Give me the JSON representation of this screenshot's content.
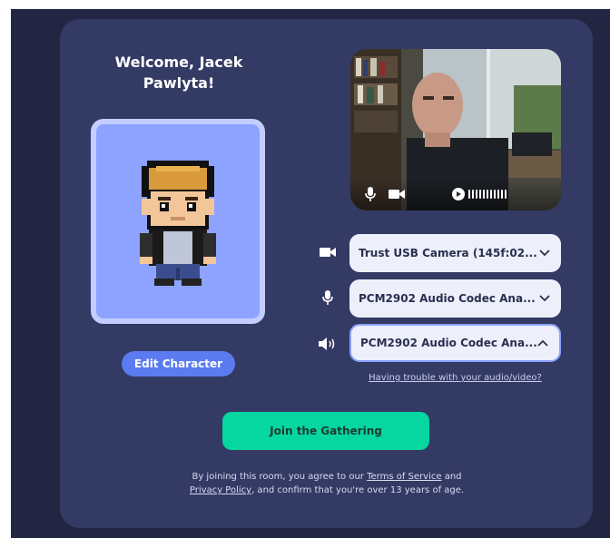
{
  "welcome": {
    "title": "Welcome, Jacek Pawlyta!"
  },
  "avatar": {
    "icon": "pixel-character-avatar",
    "edit_label": "Edit Character"
  },
  "video": {
    "controls": [
      {
        "icon": "microphone-icon"
      },
      {
        "icon": "video-camera-icon"
      },
      {
        "icon": "play-icon"
      }
    ],
    "audio_level_bars": 11
  },
  "devices": {
    "camera": {
      "icon": "video-camera-icon",
      "label": "Trust USB Camera (145f:02...",
      "open": false
    },
    "microphone": {
      "icon": "microphone-icon",
      "label": "PCM2902 Audio Codec Ana...",
      "open": false
    },
    "speaker": {
      "icon": "speaker-icon",
      "label": "PCM2902 Audio Codec Ana...",
      "open": true
    }
  },
  "trouble_link": "Having trouble with your audio/video?",
  "join": {
    "label": "Join the Gathering"
  },
  "legal": {
    "prefix": "By joining this room, you agree to our ",
    "terms": "Terms of Service",
    "and": " and",
    "privacy": "Privacy Policy",
    "suffix": ", and confirm that you're over 13 years of age."
  },
  "colors": {
    "card": "#333a64",
    "backdrop": "#232642",
    "accent_blue": "#5b7bf0",
    "join_green": "#06d6a0"
  }
}
